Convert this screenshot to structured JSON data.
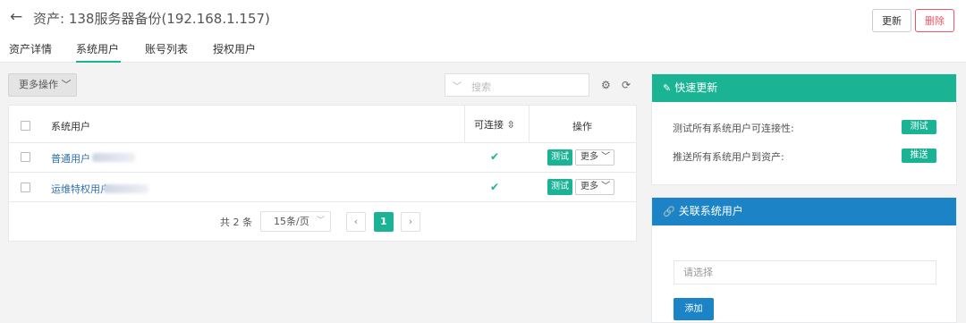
{
  "header": {
    "title": "资产: 138服务器备份(192.168.1.157)",
    "update_label": "更新",
    "delete_label": "删除",
    "tabs": [
      {
        "label": "资产详情",
        "active": false
      },
      {
        "label": "系统用户",
        "active": true
      },
      {
        "label": "账号列表",
        "active": false
      },
      {
        "label": "授权用户",
        "active": false
      }
    ]
  },
  "toolbar": {
    "more_ops_label": "更多操作 ﹀",
    "search_placeholder": "搜索"
  },
  "table": {
    "columns": {
      "user": "系统用户",
      "connectable": "可连接 ⇳",
      "actions": "操作"
    },
    "rows": [
      {
        "user": "普通用户",
        "connectable": true,
        "test_label": "测试",
        "more_label": "更多 ﹀"
      },
      {
        "user": "运维特权用户",
        "connectable": true,
        "test_label": "测试",
        "more_label": "更多 ﹀"
      }
    ]
  },
  "pagination": {
    "total_text": "共 2 条",
    "page_size": "15条/页",
    "current_page": "1",
    "prev_glyph": "‹",
    "next_glyph": "›"
  },
  "quick_update": {
    "title": "快速更新",
    "test_connectivity_label": "测试所有系统用户可连接性:",
    "test_button": "测试",
    "push_label": "推送所有系统用户到资产:",
    "push_button": "推送"
  },
  "associate": {
    "title": "关联系统用户",
    "select_placeholder": "请选择",
    "add_button": "添加"
  },
  "colors": {
    "accent_green": "#1ab394",
    "accent_blue": "#1c84c6",
    "danger": "#ed5565"
  }
}
